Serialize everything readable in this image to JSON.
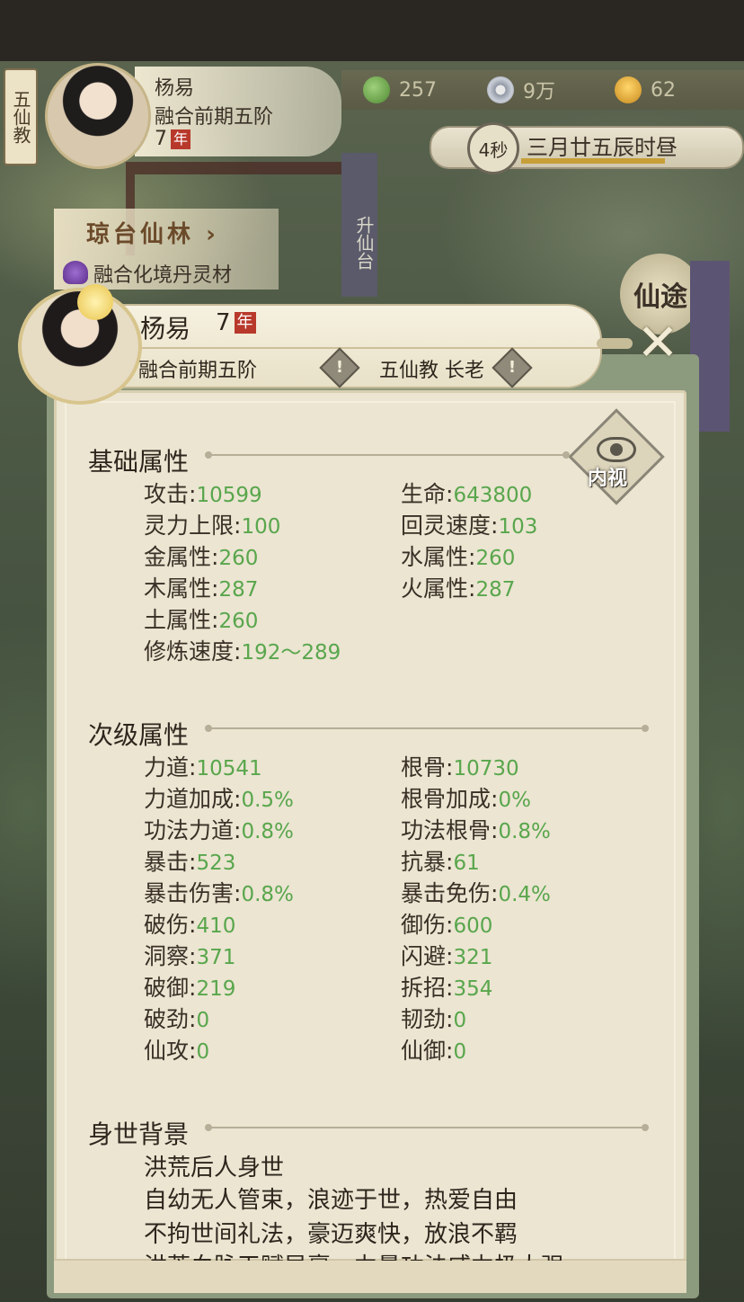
{
  "top_hud": {
    "sect_tab": "五仙教",
    "player_name": "杨易",
    "realm": "融合前期五阶",
    "age": "7",
    "age_unit": "年",
    "resources": [
      {
        "icon": "jade-icon",
        "value": "257"
      },
      {
        "icon": "spirit-coin-icon",
        "value": "9万"
      },
      {
        "icon": "gold-ingot-icon",
        "value": "62"
      }
    ],
    "timer_seconds": "4秒",
    "game_time": "三月廿五辰时昼"
  },
  "location": {
    "title": "琼台仙林",
    "arrow": "›",
    "subtitle": "融合化境丹灵材"
  },
  "scene_labels": {
    "ascend_sign": "升仙台",
    "emblem": "仙途"
  },
  "panel": {
    "name": "杨易",
    "age": "7",
    "age_unit": "年",
    "realm": "融合前期五阶",
    "sect_role": "五仙教 长老",
    "warn_glyph": "!",
    "close_glyph": "✕",
    "inner_view_label": "内视",
    "basic_title": "基础属性",
    "basic_stats": [
      {
        "label": "攻击",
        "value": "10599"
      },
      {
        "label": "生命",
        "value": "643800"
      },
      {
        "label": "灵力上限",
        "value": "100"
      },
      {
        "label": "回灵速度",
        "value": "103"
      },
      {
        "label": "金属性",
        "value": "260"
      },
      {
        "label": "水属性",
        "value": "260"
      },
      {
        "label": "木属性",
        "value": "287"
      },
      {
        "label": "火属性",
        "value": "287"
      },
      {
        "label": "土属性",
        "value": "260"
      },
      {
        "label": "修炼速度",
        "value": "192～289"
      }
    ],
    "secondary_title": "次级属性",
    "secondary_stats": [
      {
        "label": "力道",
        "value": "10541"
      },
      {
        "label": "根骨",
        "value": "10730"
      },
      {
        "label": "力道加成",
        "value": "0.5%"
      },
      {
        "label": "根骨加成",
        "value": "0%"
      },
      {
        "label": "功法力道",
        "value": "0.8%"
      },
      {
        "label": "功法根骨",
        "value": "0.8%"
      },
      {
        "label": "暴击",
        "value": "523"
      },
      {
        "label": "抗暴",
        "value": "61"
      },
      {
        "label": "暴击伤害",
        "value": "0.8%"
      },
      {
        "label": "暴击免伤",
        "value": "0.4%"
      },
      {
        "label": "破伤",
        "value": "410"
      },
      {
        "label": "御伤",
        "value": "600"
      },
      {
        "label": "洞察",
        "value": "371"
      },
      {
        "label": "闪避",
        "value": "321"
      },
      {
        "label": "破御",
        "value": "219"
      },
      {
        "label": "拆招",
        "value": "354"
      },
      {
        "label": "破劲",
        "value": "0"
      },
      {
        "label": "韧劲",
        "value": "0"
      },
      {
        "label": "仙攻",
        "value": "0"
      },
      {
        "label": "仙御",
        "value": "0"
      }
    ],
    "background_title": "身世背景",
    "background_lines": [
      "洪荒后人身世",
      "自幼无人管束，浪迹于世，热爱自由",
      "不拘世间礼法，豪迈爽快，放浪不羁",
      "洪荒血脉天赋异禀，力量功法威力极大强"
    ]
  },
  "colors": {
    "value_green": "#59a64c",
    "label_dark": "#3a3026",
    "panel_bg": "#ebe5d2",
    "age_badge": "#b8392b"
  }
}
